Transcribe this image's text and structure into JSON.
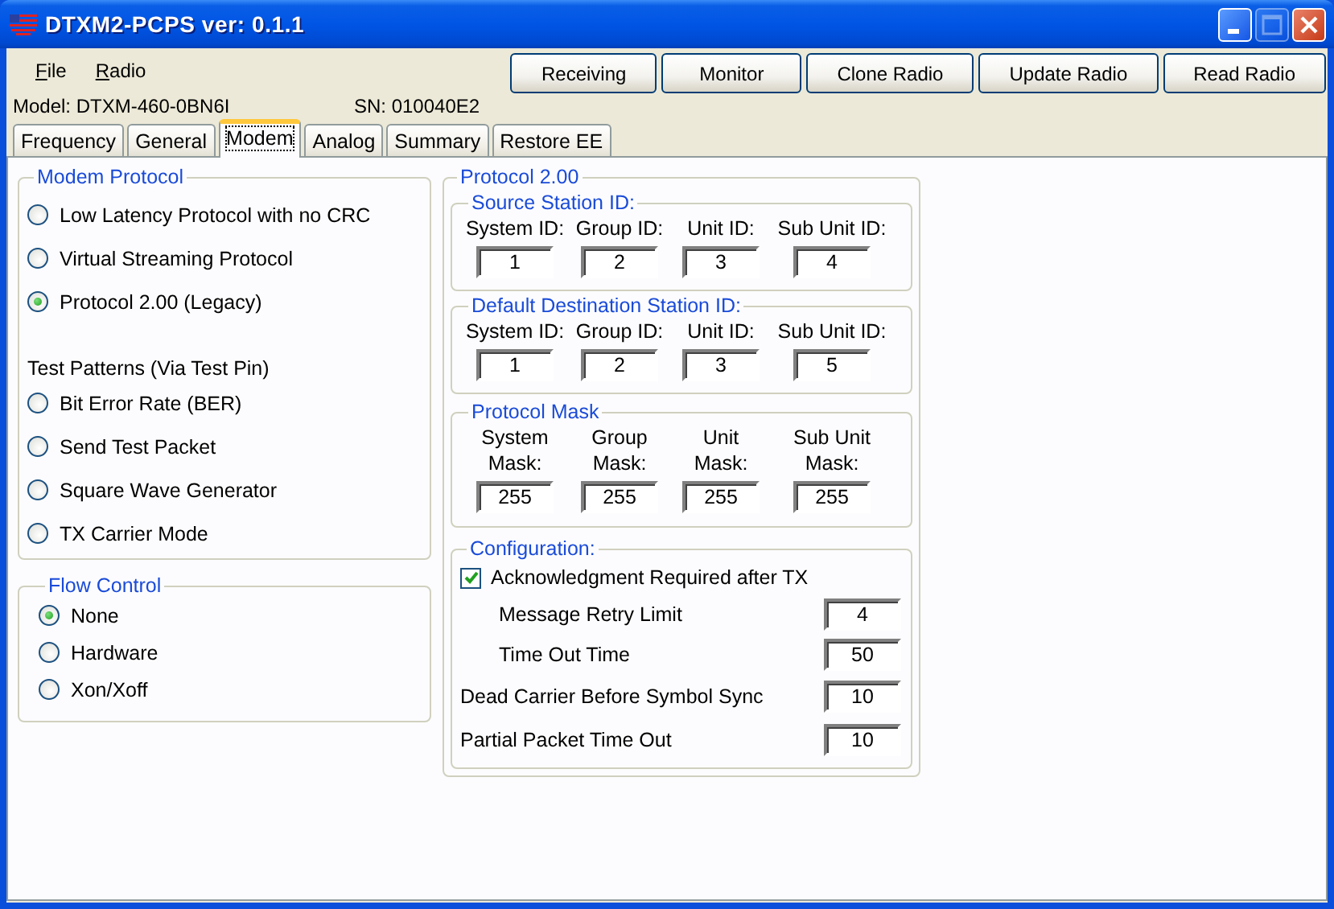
{
  "window": {
    "title": "DTXM2-PCPS ver: 0.1.1",
    "controls": [
      {
        "kind": "minimize",
        "disabled": false
      },
      {
        "kind": "maximize",
        "disabled": true
      },
      {
        "kind": "close",
        "disabled": false
      }
    ]
  },
  "menu": [
    "File",
    "Radio"
  ],
  "toolbar": [
    "Receiving",
    "Monitor",
    "Clone Radio",
    "Update Radio",
    "Read Radio"
  ],
  "info": {
    "model": "Model: DTXM-460-0BN6I",
    "serial": "SN: 010040E2"
  },
  "tabs": [
    {
      "label": "Frequency",
      "selected": false
    },
    {
      "label": "General",
      "selected": false
    },
    {
      "label": "Modem",
      "selected": true
    },
    {
      "label": "Analog",
      "selected": false
    },
    {
      "label": "Summary",
      "selected": false
    },
    {
      "label": "Restore EE",
      "selected": false
    }
  ],
  "modem_protocol": {
    "title": "Modem Protocol",
    "options": [
      {
        "label": "Low Latency Protocol with no CRC",
        "selected": false
      },
      {
        "label": "Virtual Streaming Protocol",
        "selected": false
      },
      {
        "label": "Protocol 2.00 (Legacy)",
        "selected": true
      }
    ],
    "test_patterns_title": "Test Patterns (Via Test Pin)",
    "test_patterns": [
      {
        "label": "Bit Error Rate (BER)",
        "selected": false
      },
      {
        "label": "Send Test Packet",
        "selected": false
      },
      {
        "label": "Square Wave Generator",
        "selected": false
      },
      {
        "label": "TX Carrier Mode",
        "selected": false
      }
    ]
  },
  "flow_control": {
    "title": "Flow Control",
    "options": [
      {
        "label": "None",
        "selected": true
      },
      {
        "label": "Hardware",
        "selected": false
      },
      {
        "label": "Xon/Xoff",
        "selected": false
      }
    ]
  },
  "protocol_2": {
    "title": "Protocol 2.00",
    "groups": [
      {
        "title": "Source Station ID:",
        "fields": [
          {
            "label": "System ID:",
            "value": "1"
          },
          {
            "label": "Group ID:",
            "value": "2"
          },
          {
            "label": "Unit ID:",
            "value": "3"
          },
          {
            "label": "Sub Unit ID:",
            "value": "4"
          }
        ]
      },
      {
        "title": "Default Destination Station ID:",
        "fields": [
          {
            "label": "System ID:",
            "value": "1"
          },
          {
            "label": "Group ID:",
            "value": "2"
          },
          {
            "label": "Unit ID:",
            "value": "3"
          },
          {
            "label": "Sub Unit ID:",
            "value": "5"
          }
        ]
      },
      {
        "title": "Protocol Mask",
        "fields": [
          {
            "label": "System Mask:",
            "value": "255"
          },
          {
            "label": "Group Mask:",
            "value": "255"
          },
          {
            "label": "Unit Mask:",
            "value": "255"
          },
          {
            "label": "Sub Unit Mask:",
            "value": "255"
          }
        ]
      }
    ],
    "configuration": {
      "title": "Configuration:",
      "ack": {
        "label": "Acknowledgment Required after TX",
        "checked": true
      },
      "settings": [
        {
          "kind": "sub",
          "label": "Message Retry Limit",
          "value": "4"
        },
        {
          "kind": "sub",
          "label": "Time Out Time",
          "value": "50"
        },
        {
          "kind": "main",
          "label": "Dead Carrier Before Symbol Sync",
          "value": "10"
        },
        {
          "kind": "main",
          "label": "Partial Packet Time Out",
          "value": "10"
        }
      ]
    }
  }
}
